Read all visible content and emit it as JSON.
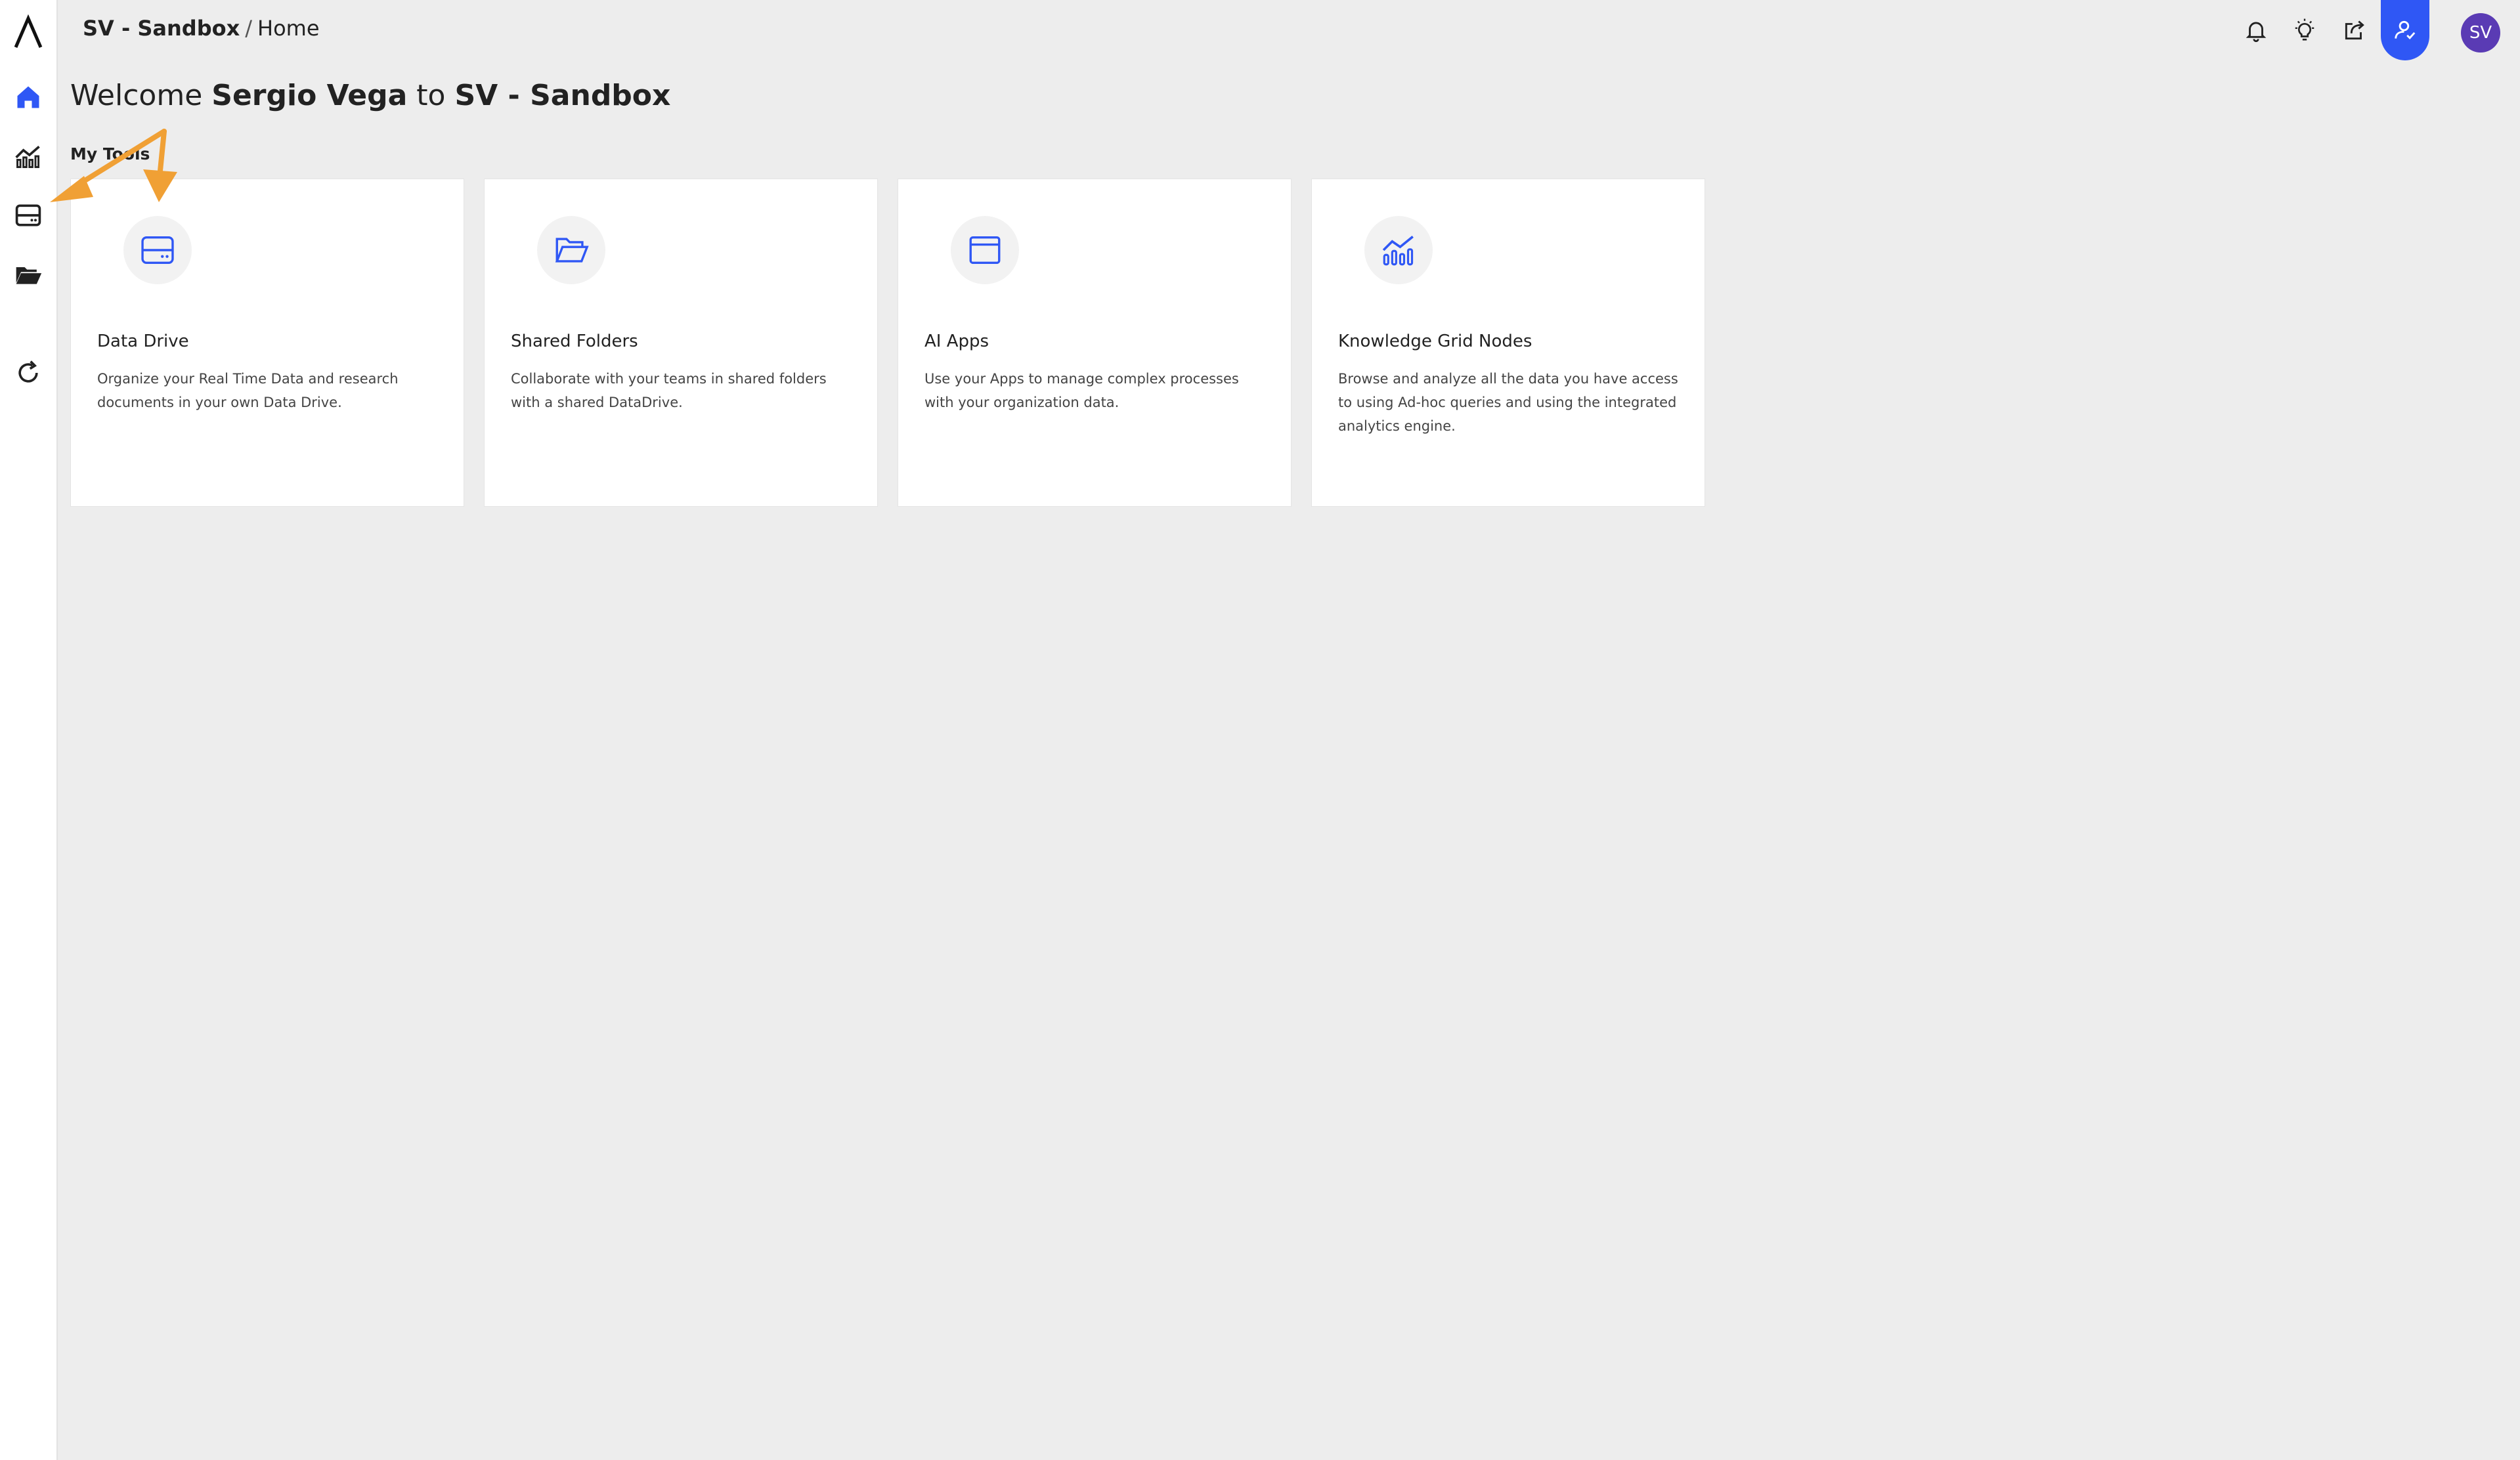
{
  "breadcrumb": {
    "workspace": "SV - Sandbox",
    "separator": "/",
    "page": "Home"
  },
  "welcome": {
    "prefix": "Welcome",
    "user": "Sergio Vega",
    "middle": "to",
    "workspace": "SV - Sandbox"
  },
  "section_label": "My Tools",
  "avatar_initials": "SV",
  "colors": {
    "accent": "#2f57f5",
    "avatar": "#5a3bb4",
    "annotation_arrow": "#f0a035",
    "background": "#ededed"
  },
  "sidebar": {
    "items": [
      {
        "icon": "home-icon"
      },
      {
        "icon": "analytics-chart-icon"
      },
      {
        "icon": "data-drive-icon"
      },
      {
        "icon": "folder-open-icon"
      },
      {
        "icon": "refresh-icon"
      }
    ]
  },
  "topbar": {
    "icons": [
      "bell-icon",
      "lightbulb-icon",
      "share-icon",
      "user-manage-icon"
    ]
  },
  "cards": [
    {
      "title": "Data Drive",
      "description": "Organize your Real Time Data and research documents in your own Data Drive.",
      "icon": "data-drive-icon"
    },
    {
      "title": "Shared Folders",
      "description": "Collaborate with your teams in shared folders with a shared DataDrive.",
      "icon": "folder-open-icon"
    },
    {
      "title": "AI Apps",
      "description": "Use your Apps to manage complex processes with your organization data.",
      "icon": "app-window-icon"
    },
    {
      "title": "Knowledge Grid Nodes",
      "description": "Browse and analyze all the data you have access to using Ad-hoc queries and using the integrated analytics engine.",
      "icon": "analytics-chart-icon"
    }
  ]
}
